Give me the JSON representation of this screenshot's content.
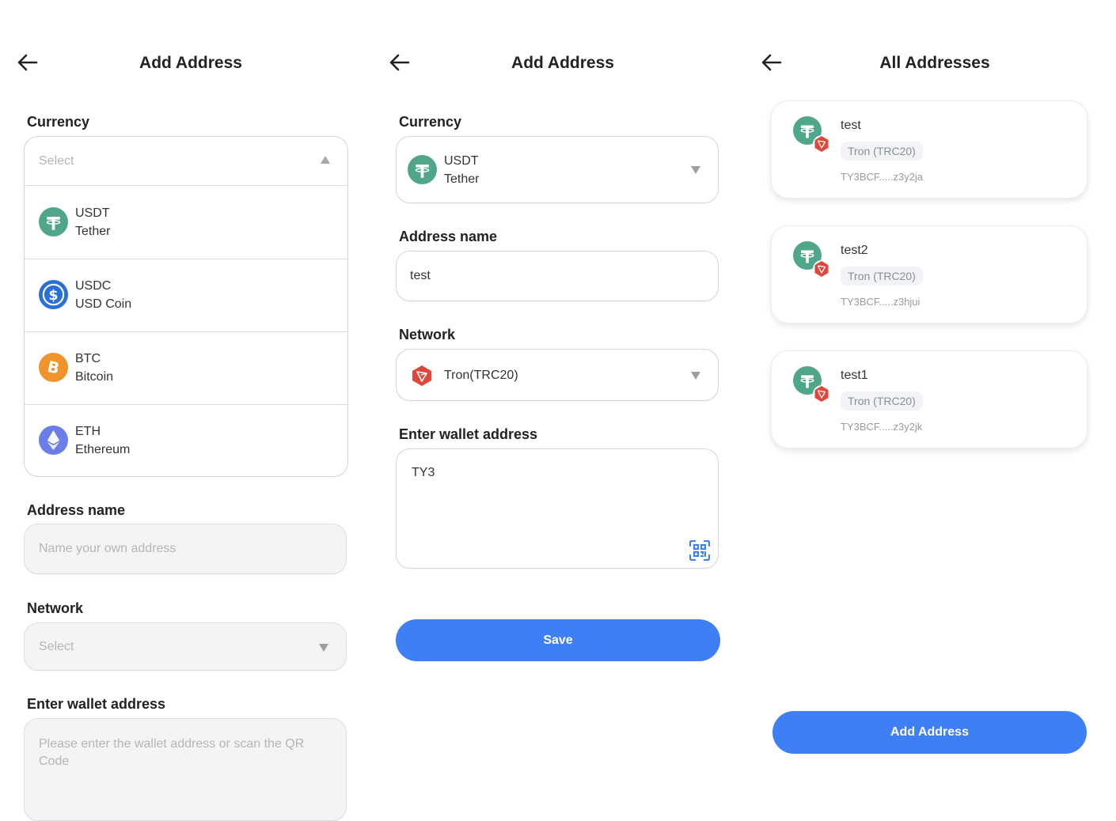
{
  "screen1": {
    "title": "Add Address",
    "currency_label": "Currency",
    "currency_placeholder": "Select",
    "currencies": [
      {
        "symbol": "USDT",
        "name": "Tether",
        "icon": "tether-icon",
        "color": "#50a68a"
      },
      {
        "symbol": "USDC",
        "name": "USD Coin",
        "icon": "usdc-icon",
        "color": "#2a6fd4"
      },
      {
        "symbol": "BTC",
        "name": "Bitcoin",
        "icon": "bitcoin-icon",
        "color": "#f0932a"
      },
      {
        "symbol": "ETH",
        "name": "Ethereum",
        "icon": "ethereum-icon",
        "color": "#6b7ee8"
      }
    ],
    "address_name_label": "Address name",
    "address_name_placeholder": "Name your own address",
    "network_label": "Network",
    "network_placeholder": "Select",
    "wallet_label": "Enter wallet address",
    "wallet_placeholder": "Please enter the wallet address or scan the QR Code"
  },
  "screen2": {
    "title": "Add Address",
    "currency_label": "Currency",
    "currency_symbol": "USDT",
    "currency_name": "Tether",
    "address_name_label": "Address name",
    "address_name_value": "test",
    "network_label": "Network",
    "network_value": "Tron(TRC20)",
    "wallet_label": "Enter wallet address",
    "wallet_value": "TY3",
    "save_label": "Save"
  },
  "screen3": {
    "title": "All Addresses",
    "addresses": [
      {
        "name": "test",
        "network": "Tron (TRC20)",
        "address": "TY3BCF.....z3y2ja"
      },
      {
        "name": "test2",
        "network": "Tron (TRC20)",
        "address": "TY3BCF.....z3hjui"
      },
      {
        "name": "test1",
        "network": "Tron (TRC20)",
        "address": "TY3BCF.....z3y2jk"
      }
    ],
    "add_button_label": "Add Address"
  },
  "colors": {
    "primary": "#3f7ff5",
    "tether": "#50a68a",
    "tron": "#e0473a"
  }
}
